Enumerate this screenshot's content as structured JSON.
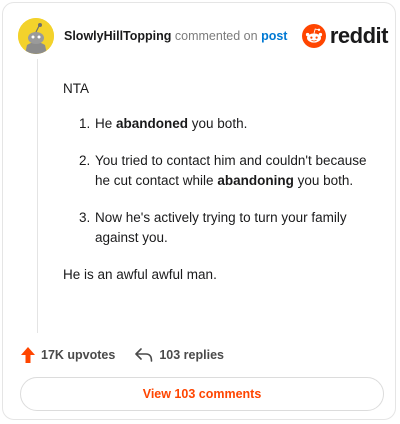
{
  "header": {
    "username": "SlowlyHillTopping",
    "action": "commented on",
    "target_link": "post",
    "brand": "reddit"
  },
  "comment": {
    "intro": "NTA",
    "items": [
      {
        "number": "1.",
        "parts": [
          "He ",
          "abandoned",
          " you both."
        ]
      },
      {
        "number": "2.",
        "parts": [
          "You tried to contact him and couldn't because he cut contact while ",
          "abandoning",
          " you both."
        ]
      },
      {
        "number": "3.",
        "parts": [
          "Now he's actively trying to turn your family against you."
        ]
      }
    ],
    "outro": "He is an awful awful man."
  },
  "footer": {
    "upvotes": "17K upvotes",
    "replies": "103 replies"
  },
  "view_button": "View 103 comments",
  "colors": {
    "accent": "#ff4500",
    "link": "#0079d3",
    "avatar": "#f3d22b"
  },
  "icons": {
    "avatar": "snoo-avatar-icon",
    "brand": "reddit-logo-icon",
    "upvote": "upvote-arrow-icon",
    "reply": "reply-arrow-icon"
  }
}
